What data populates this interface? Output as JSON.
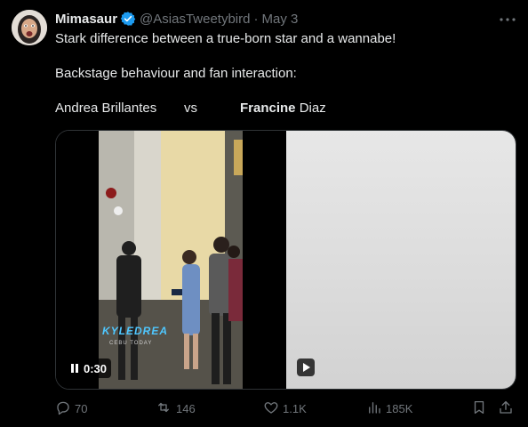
{
  "tweet": {
    "author_name": "Mimasaur",
    "handle": "@AsiasTweetybird",
    "separator": "·",
    "date": "May 3",
    "lines": [
      "Stark difference between a true-born star and a wannabe!",
      "Backstage behaviour and fan interaction:"
    ],
    "vs_left": "Andrea Brillantes",
    "vs_word": "vs",
    "vs_right_first": "Francine",
    "vs_right_last": " Diaz"
  },
  "media": {
    "left_video": {
      "time": "0:30",
      "watermark": "KYLEDREA",
      "watermark_sub": "CEBU TODAY"
    }
  },
  "actions": {
    "replies": "70",
    "reposts": "146",
    "likes": "1.1K",
    "views": "185K"
  },
  "colors": {
    "background": "#000000",
    "text": "#e7e9ea",
    "muted": "#71767b",
    "verified": "#1d9bf0"
  },
  "icons": [
    "verified-badge-icon",
    "more-icon",
    "pause-icon",
    "play-icon",
    "reply-icon",
    "repost-icon",
    "like-icon",
    "views-icon",
    "bookmark-icon",
    "share-icon"
  ]
}
